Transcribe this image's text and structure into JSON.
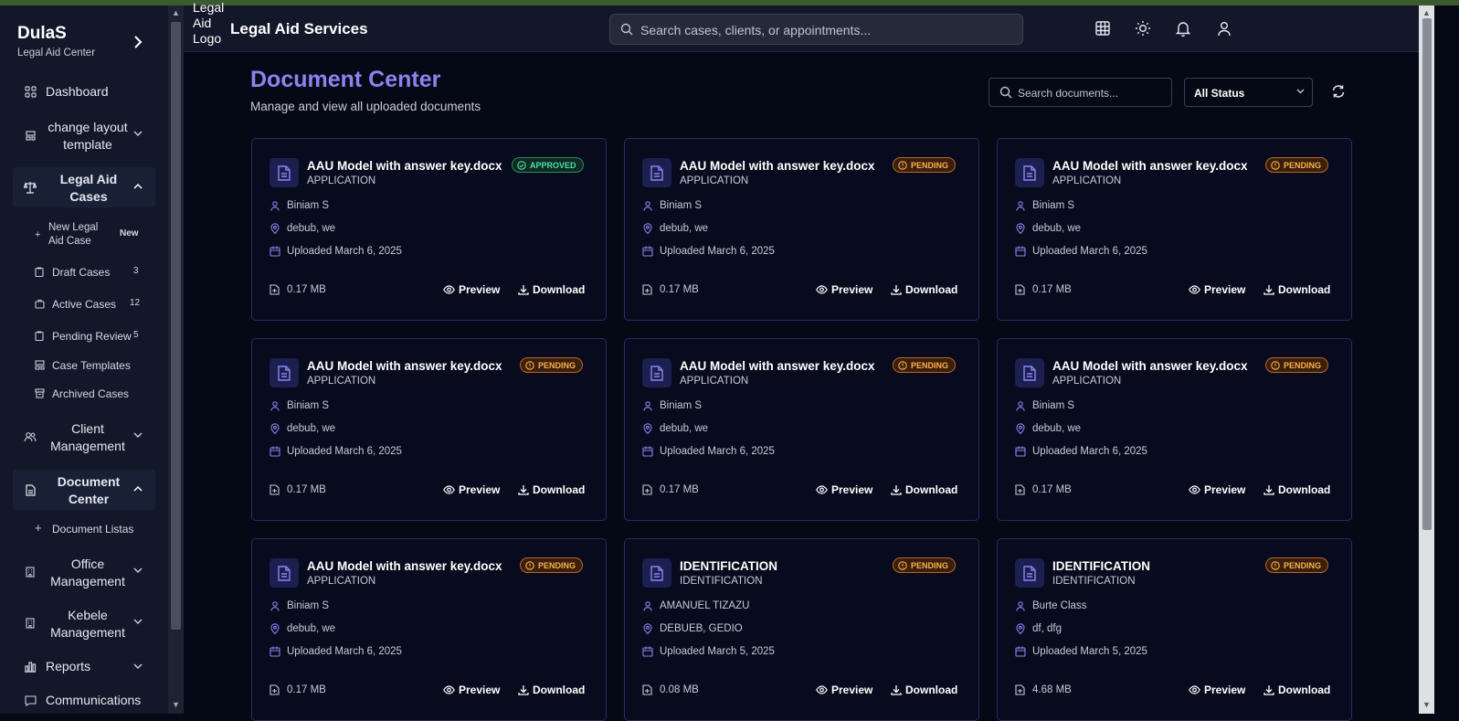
{
  "sidebar": {
    "brand_name": "DulaS",
    "brand_sub": "Legal Aid Center",
    "items": {
      "dashboard": "Dashboard",
      "layout": "change layout template",
      "legal_aid_cases": "Legal Aid Cases",
      "client_management": "Client Management",
      "document_center": "Document Center",
      "office_management": "Office Management",
      "kebele_management": "Kebele Management",
      "reports": "Reports",
      "communications": "Communications"
    },
    "case_sub": {
      "new_case": "New Legal Aid Case",
      "new_badge": "New",
      "draft": "Draft Cases",
      "draft_count": "3",
      "active": "Active Cases",
      "active_count": "12",
      "pending": "Pending Review",
      "pending_count": "5",
      "templates": "Case Templates",
      "archived": "Archived Cases"
    },
    "doc_sub": {
      "document_list": "Document Listas"
    }
  },
  "header": {
    "logo_alt": "Legal Aid Logo",
    "title": "Legal Aid Services",
    "search_placeholder": "Search cases, clients, or appointments..."
  },
  "main": {
    "title": "Document Center",
    "subtitle": "Manage and view all uploaded documents",
    "search_placeholder": "Search documents...",
    "status_filter": "All Status",
    "preview_label": "Preview",
    "download_label": "Download"
  },
  "cards": [
    {
      "title": "AAU Model with answer key.docx",
      "type": "APPLICATION",
      "status": "APPROVED",
      "client": "Biniam S",
      "location": "debub, we",
      "uploaded": "Uploaded March 6, 2025",
      "size": "0.17 MB"
    },
    {
      "title": "AAU Model with answer key.docx",
      "type": "APPLICATION",
      "status": "PENDING",
      "client": "Biniam S",
      "location": "debub, we",
      "uploaded": "Uploaded March 6, 2025",
      "size": "0.17 MB"
    },
    {
      "title": "AAU Model with answer key.docx",
      "type": "APPLICATION",
      "status": "PENDING",
      "client": "Biniam S",
      "location": "debub, we",
      "uploaded": "Uploaded March 6, 2025",
      "size": "0.17 MB"
    },
    {
      "title": "AAU Model with answer key.docx",
      "type": "APPLICATION",
      "status": "PENDING",
      "client": "Biniam S",
      "location": "debub, we",
      "uploaded": "Uploaded March 6, 2025",
      "size": "0.17 MB"
    },
    {
      "title": "AAU Model with answer key.docx",
      "type": "APPLICATION",
      "status": "PENDING",
      "client": "Biniam S",
      "location": "debub, we",
      "uploaded": "Uploaded March 6, 2025",
      "size": "0.17 MB"
    },
    {
      "title": "AAU Model with answer key.docx",
      "type": "APPLICATION",
      "status": "PENDING",
      "client": "Biniam S",
      "location": "debub, we",
      "uploaded": "Uploaded March 6, 2025",
      "size": "0.17 MB"
    },
    {
      "title": "AAU Model with answer key.docx",
      "type": "APPLICATION",
      "status": "PENDING",
      "client": "Biniam S",
      "location": "debub, we",
      "uploaded": "Uploaded March 6, 2025",
      "size": "0.17 MB"
    },
    {
      "title": "IDENTIFICATION",
      "type": "IDENTIFICATION",
      "status": "PENDING",
      "client": "AMANUEL TIZAZU",
      "location": "DEBUEB, GEDIO",
      "uploaded": "Uploaded March 5, 2025",
      "size": "0.08 MB"
    },
    {
      "title": "IDENTIFICATION",
      "type": "IDENTIFICATION",
      "status": "PENDING",
      "client": "Burte Class",
      "location": "df, dfg",
      "uploaded": "Uploaded March 5, 2025",
      "size": "4.68 MB"
    }
  ],
  "colors": {
    "accent": "#8b83f0",
    "approved": "#4fe0a3",
    "pending": "#ffb04a",
    "background": "#050916",
    "sidebar": "#121829"
  }
}
